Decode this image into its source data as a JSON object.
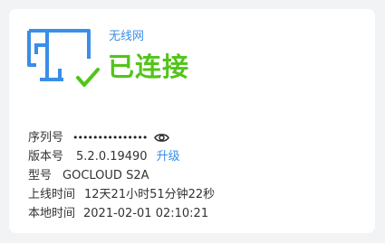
{
  "network": {
    "name": "无线网",
    "status": "已连接"
  },
  "colors": {
    "accent": "#3a8ee6",
    "success": "#52c41a",
    "text": "#333333",
    "background": "#f2f3f5"
  },
  "icons": {
    "device": "device-connected-icon",
    "reveal": "eye-icon"
  },
  "details": {
    "serial": {
      "label": "序列号",
      "value": "•••••••••••••••"
    },
    "version": {
      "label": "版本号",
      "value": "5.2.0.19490",
      "upgrade_label": "升级"
    },
    "model": {
      "label": "型号",
      "value": "GOCLOUD S2A"
    },
    "uptime": {
      "label": "上线时间",
      "value": "12天21小时51分钟22秒"
    },
    "local_time": {
      "label": "本地时间",
      "value": "2021-02-01 02:10:21"
    }
  }
}
